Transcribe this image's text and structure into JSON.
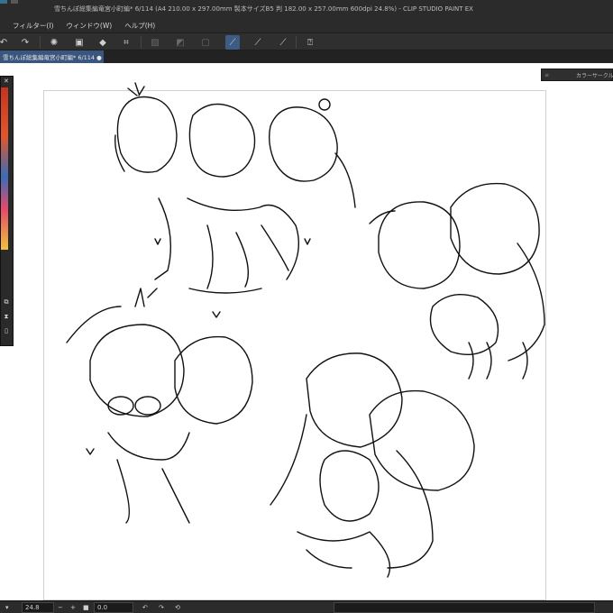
{
  "app": {
    "title": "雪ちんぽ総集編竜宮小町編* 6/114 (A4 210.00 x 297.00mm 製本サイズB5 判 182.00 x 257.00mm 600dpi 24.8%) - CLIP STUDIO PAINT EX"
  },
  "menu": {
    "items": [
      "フィルター(I)",
      "ウィンドウ(W)",
      "ヘルプ(H)"
    ]
  },
  "toolbar": {
    "icons": [
      "undo-icon",
      "redo-icon",
      "loading-icon",
      "copy-icon",
      "fill-icon",
      "transform-icon",
      "clear-icon",
      "fill-gray-icon",
      "border-icon",
      "stroke-correction-icon-1",
      "stroke-correction-icon-2",
      "stroke-correction-icon-3",
      "help-icon"
    ],
    "active_color": "#3d5c84"
  },
  "tab": {
    "label": "雪ちんぽ総集編竜宮小町編* 6/114 ●"
  },
  "right_panel": {
    "title": "カラーサークル"
  },
  "status": {
    "zoom": "24.8",
    "rotation": "0.0"
  },
  "colors": {
    "ui_bg": "#2b2b2b",
    "tab_active": "#3a567e",
    "canvas": "#ffffff"
  }
}
